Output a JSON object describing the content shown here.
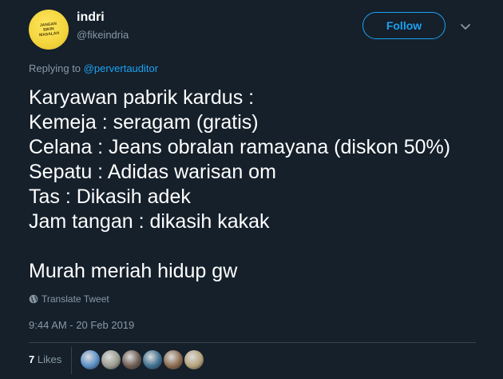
{
  "user": {
    "display_name": "indri",
    "handle": "@fikeindria",
    "avatar_text": "JANGAN BIKIN MASALAH"
  },
  "follow_label": "Follow",
  "reply": {
    "prefix": "Replying to ",
    "target": "@pervertauditor"
  },
  "body_lines": [
    "Karyawan pabrik kardus :",
    "Kemeja : seragam (gratis)",
    "Celana : Jeans obralan ramayana (diskon 50%)",
    "Sepatu : Adidas warisan om",
    "Tas : Dikasih adek",
    "Jam tangan : dikasih kakak",
    "",
    "Murah meriah hidup gw"
  ],
  "translate_label": "Translate Tweet",
  "timestamp": "9:44 AM - 20 Feb 2019",
  "likes": {
    "count": "7",
    "label": "Likes"
  },
  "liker_avatars": [
    {
      "name": "liker-1",
      "color": "#5a8fc7"
    },
    {
      "name": "liker-2",
      "color": "#9b9b8f"
    },
    {
      "name": "liker-3",
      "color": "#6d5c52"
    },
    {
      "name": "liker-4",
      "color": "#3d6e8f"
    },
    {
      "name": "liker-5",
      "color": "#8a6a4e"
    },
    {
      "name": "liker-6",
      "color": "#b5a27a"
    }
  ],
  "colors": {
    "background": "#15202b",
    "accent": "#1da1f2",
    "muted": "#8899a6"
  }
}
